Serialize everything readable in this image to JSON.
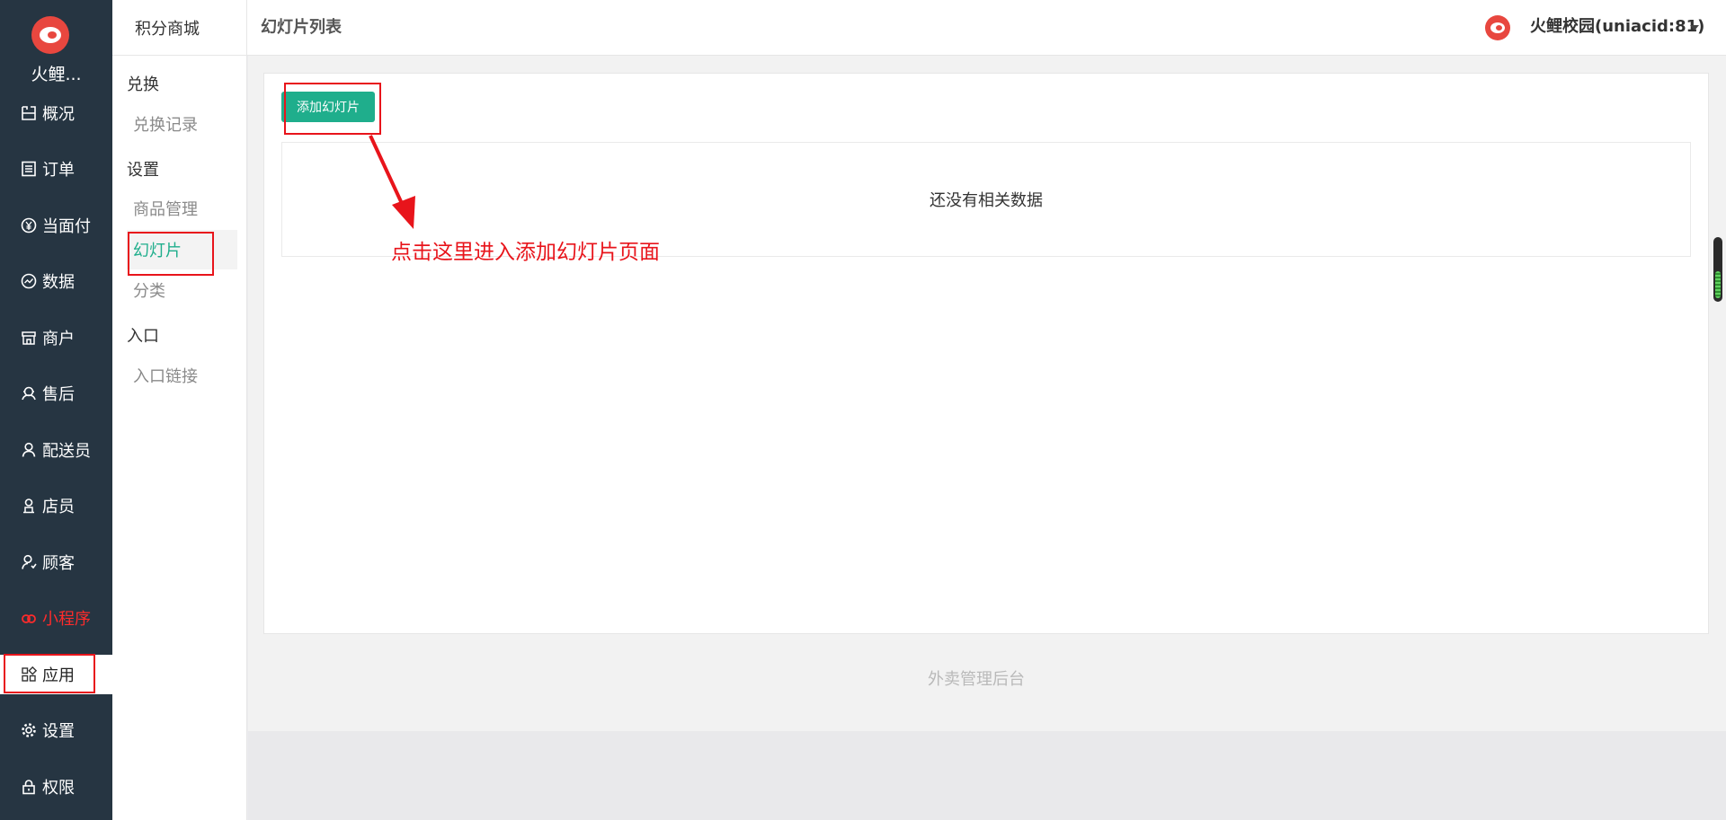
{
  "sidebar": {
    "brand": "火鲤...",
    "items": [
      {
        "label": "概况",
        "icon": "overview-icon"
      },
      {
        "label": "订单",
        "icon": "order-icon"
      },
      {
        "label": "当面付",
        "icon": "yuan-icon"
      },
      {
        "label": "数据",
        "icon": "chart-icon"
      },
      {
        "label": "商户",
        "icon": "store-icon"
      },
      {
        "label": "售后",
        "icon": "support-icon"
      },
      {
        "label": "配送员",
        "icon": "courier-icon"
      },
      {
        "label": "店员",
        "icon": "staff-icon"
      },
      {
        "label": "顾客",
        "icon": "customer-icon"
      },
      {
        "label": "小程序",
        "icon": "miniprogram-icon"
      },
      {
        "label": "应用",
        "icon": "apps-icon"
      },
      {
        "label": "设置",
        "icon": "gear-icon"
      },
      {
        "label": "权限",
        "icon": "lock-icon"
      }
    ],
    "highlight_color": "#ff2b2b",
    "background": "#263542"
  },
  "subnav": {
    "title": "积分商城",
    "groups": [
      {
        "label": "兑换",
        "items": [
          "兑换记录"
        ]
      },
      {
        "label": "设置",
        "items": [
          "商品管理",
          "幻灯片",
          "分类"
        ]
      },
      {
        "label": "入口",
        "items": [
          "入口链接"
        ]
      }
    ],
    "active_item": "幻灯片",
    "active_color": "#1fae8c"
  },
  "header": {
    "title": "幻灯片列表",
    "user": "火鲤校园(uniacid:81)"
  },
  "main": {
    "add_button_label": "添加幻灯片",
    "empty_text": "还没有相关数据",
    "footer": "外卖管理后台"
  },
  "annotation": {
    "text": "点击这里进入添加幻灯片页面",
    "color": "#e8141b"
  }
}
